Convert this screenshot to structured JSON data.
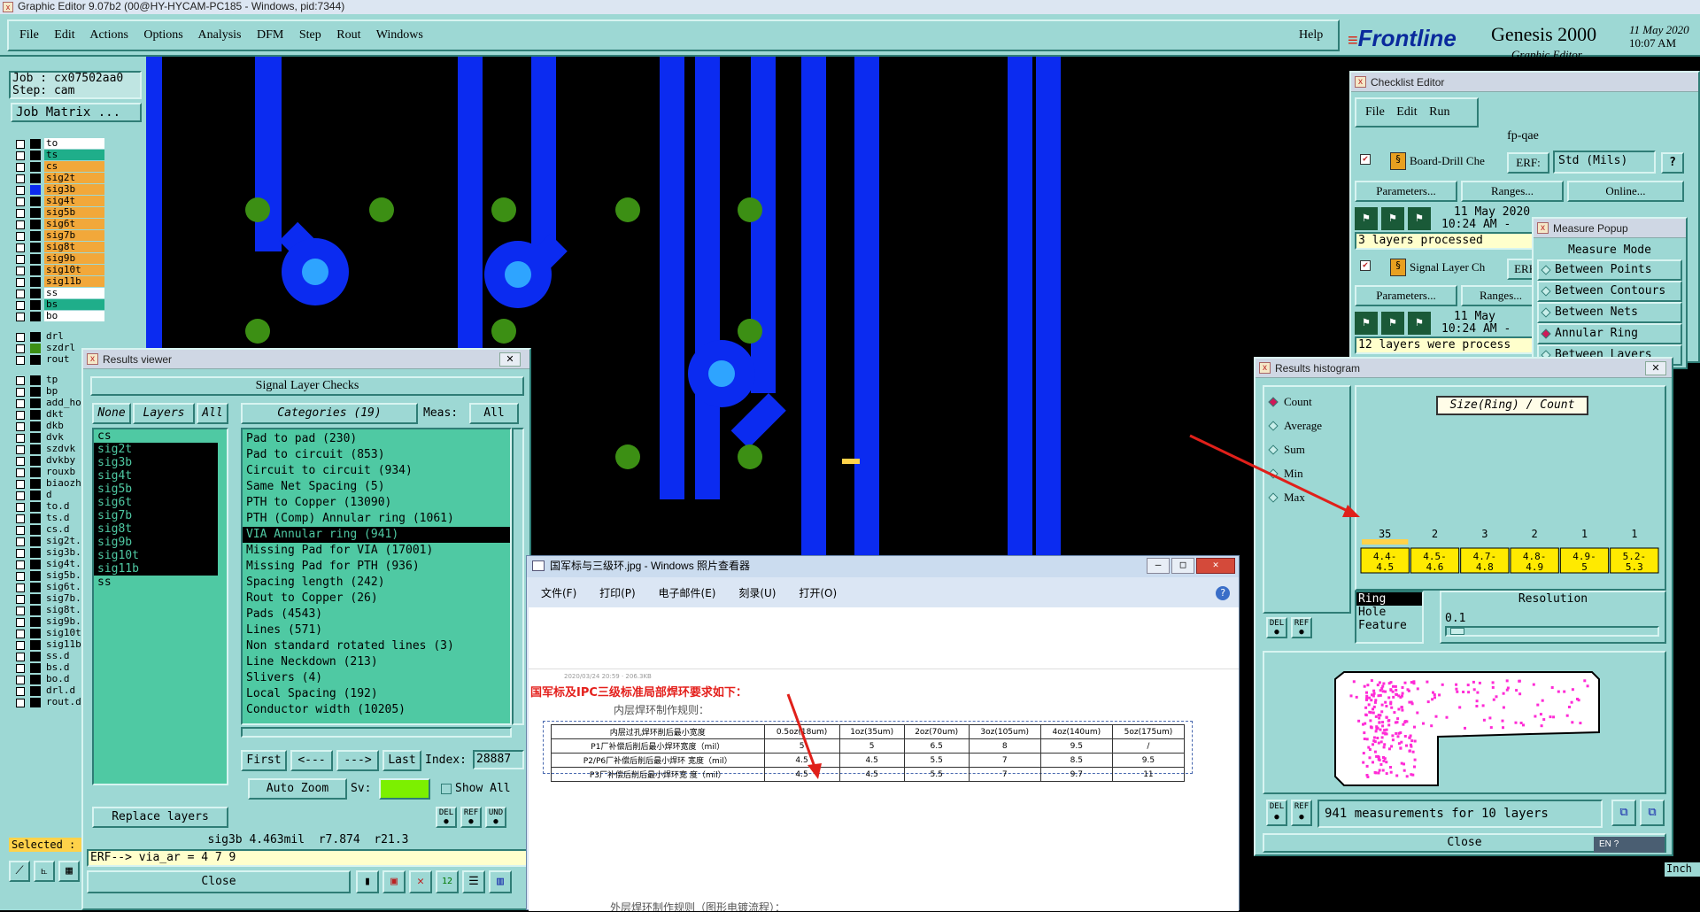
{
  "app": {
    "title": "Graphic Editor 9.07b2 (00@HY-HYCAM-PC185 - Windows, pid:7344)",
    "menu": [
      "File",
      "Edit",
      "Actions",
      "Options",
      "Analysis",
      "DFM",
      "Step",
      "Rout",
      "Windows"
    ],
    "help": "Help",
    "brand": "Frontline",
    "product": "Genesis 2000",
    "product_sub": "Graphic Editor",
    "date": "11 May 2020",
    "time": "10:07 AM"
  },
  "job": {
    "job": "Job : cx07502aa0",
    "step": "Step: cam",
    "matrix_button": "Job Matrix ..."
  },
  "layers": {
    "board": [
      "to",
      "ts",
      "cs",
      "sig2t",
      "sig3b",
      "sig4t",
      "sig5b",
      "sig6t",
      "sig7b",
      "sig8t",
      "sig9b",
      "sig10t",
      "sig11b",
      "ss",
      "bs",
      "bo"
    ],
    "drill": [
      "drl",
      "szdrl",
      "rout"
    ],
    "misc": [
      "tp",
      "bp",
      "add_ho",
      "dkt",
      "dkb",
      "dvk",
      "szdvk",
      "dvkby",
      "rouxb",
      "biaozh",
      "d",
      "to.d",
      "ts.d",
      "cs.d",
      "sig2t.",
      "sig3b.",
      "sig4t.",
      "sig5b.",
      "sig6t.",
      "sig7b.",
      "sig8t.",
      "sig9b.",
      "sig10t",
      "sig11b",
      "ss.d",
      "bs.d",
      "bo.d",
      "drl.d",
      "rout.d"
    ],
    "selected_label": "Selected :",
    "inch_label": "Inch"
  },
  "results_viewer": {
    "title": "Results viewer",
    "header": "Signal Layer Checks",
    "btn_none": "None",
    "btn_layers": "Layers",
    "btn_all": "All",
    "layers": [
      "cs",
      "sig2t",
      "sig3b",
      "sig4t",
      "sig5b",
      "sig6t",
      "sig7b",
      "sig8t",
      "sig9b",
      "sig10t",
      "sig11b",
      "ss"
    ],
    "categories_label": "Categories (19)",
    "meas_label": "Meas:",
    "meas_value": "All",
    "categories": [
      "Pad to pad (230)",
      "Pad to circuit (853)",
      "Circuit to circuit (934)",
      "Same Net Spacing (5)",
      "PTH to Copper (13090)",
      "PTH (Comp) Annular ring (1061)",
      "VIA Annular ring (941)",
      "Missing Pad for VIA (17001)",
      "Missing Pad for PTH (936)",
      "Spacing length (242)",
      "Rout to Copper (26)",
      "Pads (4543)",
      "Lines (571)",
      "Non standard rotated lines (3)",
      "Line Neckdown (213)",
      "Slivers (4)",
      "Local Spacing (192)",
      "Conductor width (10205)"
    ],
    "selected_category": 6,
    "nav_first": "First",
    "nav_prev": "<---",
    "nav_next": "--->",
    "nav_last": "Last",
    "index_label": "Index:",
    "index_value": "28887",
    "auto_zoom": "Auto Zoom",
    "sv_label": "Sv:",
    "show_all": "Show All",
    "replace_layers": "Replace layers",
    "status": "sig3b 4.463mil  r7.874  r21.3",
    "erf": "ERF--> via_ar = 4 7 9",
    "close": "Close"
  },
  "checklist": {
    "title": "Checklist Editor",
    "menu": [
      "File",
      "Edit",
      "Run"
    ],
    "name": "fp-qae",
    "check1_name": "Board-Drill Che",
    "erf_label": "ERF:",
    "erf_value": "Std (Mils)",
    "params": "Parameters...",
    "ranges": "Ranges...",
    "online": "Online...",
    "check1_date": "11 May 2020",
    "check1_time": "10:24 AM -",
    "check1_status": "3 layers processed",
    "check2_name": "Signal Layer Ch",
    "check2_erf": "ERF",
    "check2_date": "11 May",
    "check2_time": "10:24 AM -",
    "check2_status": "12 layers were process"
  },
  "measure": {
    "title": "Measure Popup",
    "header": "Measure Mode",
    "options": [
      "Between Points",
      "Between Contours",
      "Between Nets",
      "Annular Ring",
      "Between Layers"
    ]
  },
  "histogram": {
    "title": "Results histogram",
    "modes": [
      "Count",
      "Average",
      "Sum",
      "Min",
      "Max"
    ],
    "selected_mode": 0,
    "chart_title": "Size(Ring) / Count",
    "mode_list": [
      "Ring",
      "Hole",
      "Feature"
    ],
    "resolution_label": "Resolution",
    "resolution_value": "0.1",
    "summary": "941 measurements for 10 layers",
    "close": "Close",
    "lang": "EN"
  },
  "chart_data": {
    "type": "bar",
    "title": "Size(Ring) / Count",
    "categories": [
      "4.4-4.5",
      "4.5-4.6",
      "4.7-4.8",
      "4.8-4.9",
      "4.9-5",
      "5.2-5.3"
    ],
    "values": [
      35,
      2,
      3,
      2,
      1,
      1
    ]
  },
  "photo_viewer": {
    "title": "国军标与三级环.jpg - Windows 照片查看器",
    "menu": [
      "文件(F)",
      "打印(P)",
      "电子邮件(E)",
      "刻录(U)",
      "打开(O)"
    ],
    "timestamp": "2020/03/24 20:59 · 206.3KB",
    "heading": "国军标及IPC三级标准局部焊环要求如下：",
    "subheading": "内层焊环制作规则：",
    "footer": "外层焊环制作规则（图形电镀流程）：",
    "table": {
      "headers": [
        "内层过孔焊环削后最小宽度",
        "0.5oz(18um)",
        "1oz(35um)",
        "2oz(70um)",
        "3oz(105um)",
        "4oz(140um)",
        "5oz(175um)"
      ],
      "rows": [
        [
          "P1厂补偿后削后最小焊环宽度（mil）",
          "5",
          "5",
          "6.5",
          "8",
          "9.5",
          "/"
        ],
        [
          "P2/P6厂补偿后削后最小焊环 宽度（mil）",
          "4.5",
          "4.5",
          "5.5",
          "7",
          "8.5",
          "9.5"
        ],
        [
          "P3厂补偿后削后最小焊环宽 度（mil）",
          "4.5",
          "4.5",
          "5.5",
          "7",
          "9.7",
          "11"
        ]
      ]
    }
  },
  "colors": {
    "teal": "#9dd8d4",
    "green": "#4fc9a3",
    "trace": "#0b2bf0",
    "pad": "#3c8f14",
    "via": "#2ea4ff",
    "highlight": "#ffd24a",
    "arrow": "#e0201a"
  }
}
